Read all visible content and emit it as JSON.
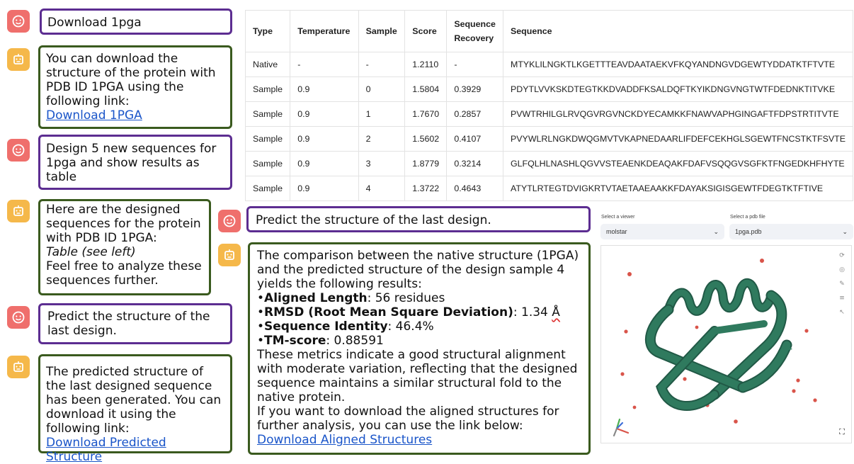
{
  "left_chat": [
    {
      "role": "user",
      "text": "Download 1pga"
    },
    {
      "role": "bot",
      "text": "You can download the structure of the protein with PDB ID 1PGA using the following link:",
      "link": "Download 1PGA"
    },
    {
      "role": "user",
      "text": "Design 5 new sequences for 1pga and show results as table"
    },
    {
      "role": "bot",
      "line1": "Here are the designed sequences for the protein with PDB ID 1PGA:",
      "italic": "Table (see left)",
      "line2": "Feel free to analyze these sequences further."
    },
    {
      "role": "user",
      "text": "Predict the structure of the last design."
    },
    {
      "role": "bot",
      "text": "The predicted structure of the last designed sequence has been generated. You can download it using the following link:",
      "link": "Download Predicted Structure"
    }
  ],
  "table": {
    "headers": [
      "Type",
      "Temperature",
      "Sample",
      "Score",
      "Sequence Recovery",
      "Sequence"
    ],
    "rows": [
      [
        "Native",
        "-",
        "-",
        "1.2110",
        "-",
        "MTYKLILNGKTLKGETTTEAVDAATAEKVFKQYANDNGVDGEWTYDDATKTFTVTE"
      ],
      [
        "Sample",
        "0.9",
        "0",
        "1.5804",
        "0.3929",
        "PDYTLVVKSKDTEGTKKDVADDFKSALDQFTKYIKDNGVNGTWTFDEDNKTITVKE"
      ],
      [
        "Sample",
        "0.9",
        "1",
        "1.7670",
        "0.2857",
        "PVWTRHILGLRVQGVRGVNCKDYECAMKKFNAWVAPHGINGAFTFDPSTRTITVTE"
      ],
      [
        "Sample",
        "0.9",
        "2",
        "1.5602",
        "0.4107",
        "PVYWLRLNGKDWQGMVTVKAPNEDAARLIFDEFCEKHGLSGEWTFNCSTKTFSVTE"
      ],
      [
        "Sample",
        "0.9",
        "3",
        "1.8779",
        "0.3214",
        "GLFQLHLNASHLQGVVSTEAENKDEAQAKFDAFVSQQGVSGFKTFNGEDKHFHYTE"
      ],
      [
        "Sample",
        "0.9",
        "4",
        "1.3722",
        "0.4643",
        "ATYTLRTEGTDVIGKRTVTAETAAEAAKKFDAYAKSIGISGEWTFDEGTKTFTIVE"
      ]
    ]
  },
  "right_chat": {
    "user_text": "Predict the structure of the last design.",
    "bot_intro": "The comparison between the native structure (1PGA) and the predicted structure of the design sample 4 yields the following results:",
    "bullet": "•",
    "m1_label": "Aligned Length",
    "m1_value": ": 56 residues",
    "m2_label": "RMSD (Root Mean Square Deviation)",
    "m2_value": ": 1.34 ",
    "m2_unit": "Å",
    "m3_label": "Sequence Identity",
    "m3_value": ": 46.4%",
    "m4_label": "TM-score",
    "m4_value": ": 0.88591",
    "para1": "These metrics indicate a good structural alignment with moderate variation, reflecting that the designed sequence maintains a similar structural fold to the native protein.",
    "para2": "If you want to download the aligned structures for further analysis, you can use the link below:",
    "link": "Download Aligned Structures"
  },
  "viewer": {
    "viewer_label": "Select a viewer",
    "viewer_value": "molstar",
    "pdb_label": "Select a pdb file",
    "pdb_value": "1pga.pdb",
    "chevron": "⌄",
    "colors": {
      "ribbon": "#2f7a5e",
      "ribbon_dark": "#215946",
      "dots": "#d9544a",
      "user": "#ef6f6c",
      "bot": "#f5b84a",
      "user_border": "#5c2d91",
      "bot_border": "#3a5a1e"
    }
  }
}
